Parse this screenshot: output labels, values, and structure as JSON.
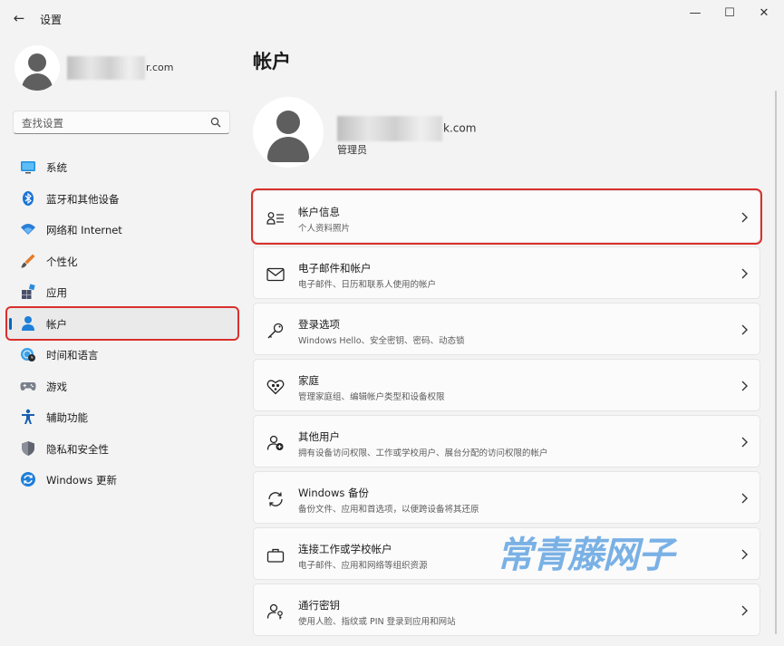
{
  "window": {
    "back": "←",
    "title": "设置",
    "minimize": "—",
    "maximize": "☐",
    "close": "✕"
  },
  "profile": {
    "email_suffix": "r.com"
  },
  "search": {
    "placeholder": "查找设置"
  },
  "sidebar": {
    "items": [
      {
        "label": "系统",
        "icon": "system-display-icon"
      },
      {
        "label": "蓝牙和其他设备",
        "icon": "bluetooth-icon"
      },
      {
        "label": "网络和 Internet",
        "icon": "wifi-icon"
      },
      {
        "label": "个性化",
        "icon": "paintbrush-icon"
      },
      {
        "label": "应用",
        "icon": "apps-icon"
      },
      {
        "label": "帐户",
        "icon": "account-icon",
        "selected": true
      },
      {
        "label": "时间和语言",
        "icon": "globe-clock-icon"
      },
      {
        "label": "游戏",
        "icon": "gamepad-icon"
      },
      {
        "label": "辅助功能",
        "icon": "accessibility-icon"
      },
      {
        "label": "隐私和安全性",
        "icon": "shield-icon"
      },
      {
        "label": "Windows 更新",
        "icon": "update-icon"
      }
    ]
  },
  "main": {
    "title": "帐户",
    "user": {
      "email_suffix": "k.com",
      "role": "管理员"
    },
    "cards": [
      {
        "title": "帐户信息",
        "subtitle": "个人资料照片",
        "icon": "account-info-icon",
        "highlighted": true
      },
      {
        "title": "电子邮件和帐户",
        "subtitle": "电子邮件、日历和联系人使用的帐户",
        "icon": "mail-icon"
      },
      {
        "title": "登录选项",
        "subtitle": "Windows Hello、安全密钥、密码、动态锁",
        "icon": "key-icon"
      },
      {
        "title": "家庭",
        "subtitle": "管理家庭组、编辑帐户类型和设备权限",
        "icon": "family-heart-icon"
      },
      {
        "title": "其他用户",
        "subtitle": "拥有设备访问权限、工作或学校用户、展台分配的访问权限的帐户",
        "icon": "add-user-icon"
      },
      {
        "title": "Windows 备份",
        "subtitle": "备份文件、应用和首选项，以便跨设备将其还原",
        "icon": "backup-icon"
      },
      {
        "title": "连接工作或学校帐户",
        "subtitle": "电子邮件、应用和网络等组织资源",
        "icon": "briefcase-icon"
      },
      {
        "title": "通行密钥",
        "subtitle": "使用人脸、指纹或 PIN 登录到应用和网站",
        "icon": "passkey-icon"
      }
    ]
  },
  "watermark": "常青藤网子",
  "colors": {
    "accent": "#0067c0",
    "highlight_border": "#d9302c",
    "watermark": "#5a9fe0"
  }
}
